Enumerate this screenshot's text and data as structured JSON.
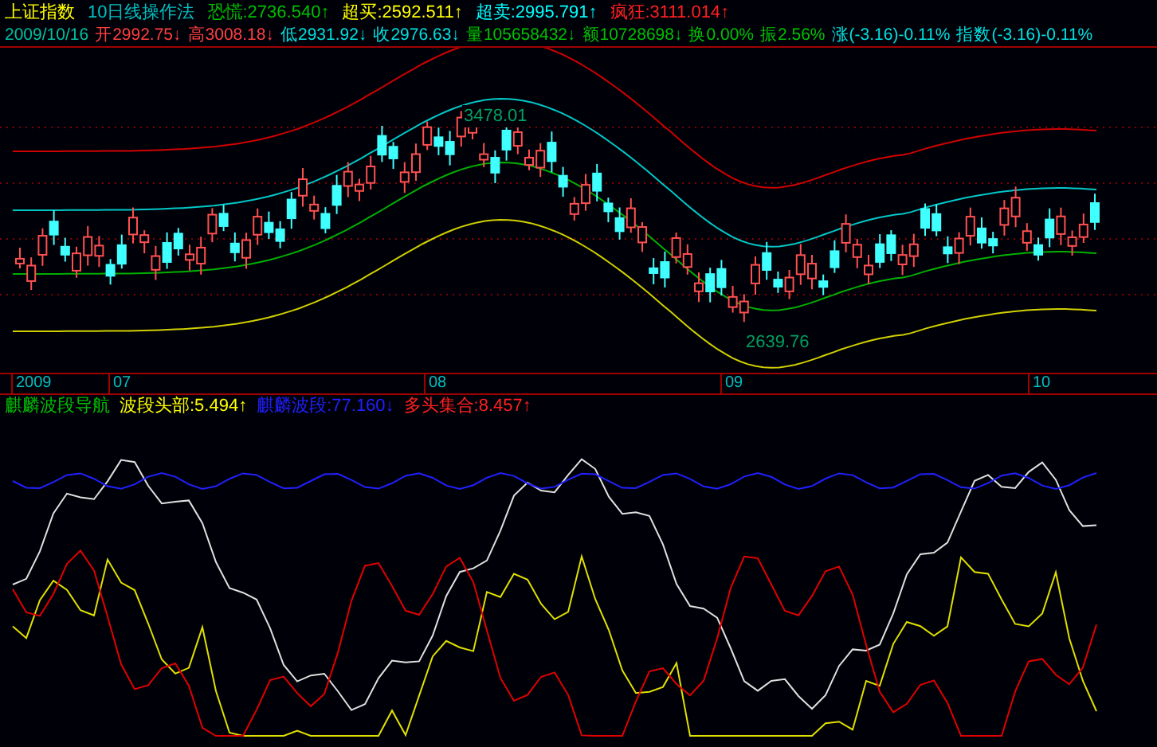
{
  "header": {
    "title": "上证指数",
    "method": "10日线操作法",
    "levels": [
      {
        "label": "恐慌",
        "value": ":2736.540",
        "arrow": "↑",
        "color": "#00c000"
      },
      {
        "label": "超买",
        "value": ":2592.511",
        "arrow": "↑",
        "color": "#ffff00"
      },
      {
        "label": "超卖",
        "value": ":2995.791",
        "arrow": "↑",
        "color": "#00ffff"
      },
      {
        "label": "疯狂",
        "value": ":3111.014",
        "arrow": "↑",
        "color": "#ff2020"
      }
    ]
  },
  "quote": {
    "date": "2009/10/16",
    "fields": [
      {
        "text": "开2992.75",
        "arrow": "↓",
        "color": "#ff4040"
      },
      {
        "text": "高3008.18",
        "arrow": "↓",
        "color": "#ff4040"
      },
      {
        "text": "低2931.92",
        "arrow": "↓",
        "color": "#00e0e0"
      },
      {
        "text": "收2976.63",
        "arrow": "↓",
        "color": "#00e0e0"
      },
      {
        "text": "量105658432",
        "arrow": "↓",
        "color": "#00c000"
      },
      {
        "text": "额10728698",
        "arrow": "↓",
        "color": "#00c000"
      },
      {
        "text": "换0.00%",
        "color": "#00c000"
      },
      {
        "text": "振2.56%",
        "color": "#00c000"
      },
      {
        "text": "涨(-3.16)-0.11%",
        "color": "#00e0e0"
      },
      {
        "text": "指数(-3.16)-0.11%",
        "color": "#00e0e0"
      }
    ]
  },
  "price_chart": {
    "high_label": "3478.01",
    "low_label": "2639.76"
  },
  "time_axis": [
    "2009",
    "07",
    "08",
    "09",
    "10"
  ],
  "indicator": {
    "title": "麒麟波段导航",
    "values": [
      {
        "label": "波段头部:5.494",
        "arrow": "↑",
        "color": "#ffff00"
      },
      {
        "label": "麒麟波段:77.160",
        "arrow": "↓",
        "color": "#2020ff"
      },
      {
        "label": "多头集合:8.457",
        "arrow": "↑",
        "color": "#ff2020"
      }
    ]
  }
}
